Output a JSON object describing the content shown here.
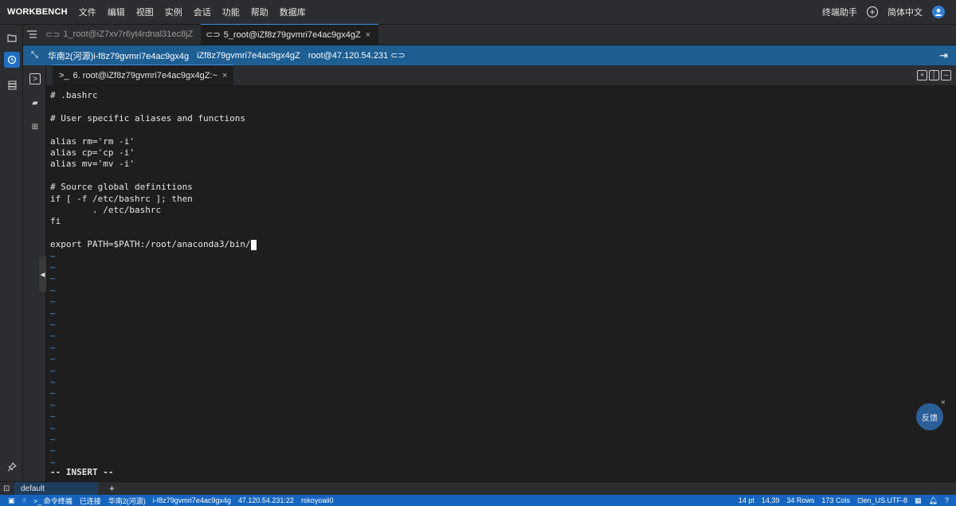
{
  "app": {
    "brand": "WORKBENCH",
    "menu": [
      "文件",
      "编辑",
      "视图",
      "实例",
      "会话",
      "功能",
      "帮助",
      "数据库"
    ],
    "assistant": "终端助手",
    "language": "简体中文"
  },
  "session_tabs": [
    {
      "label": "1_root@iZ7xv7r6yt4rdnal31ec8jZ",
      "active": false
    },
    {
      "label": "5_root@iZf8z79gvmri7e4ac9gx4gZ",
      "active": true
    }
  ],
  "infobar": {
    "region_instance": "华南2(河源)i-f8z79gvmri7e4ac9gx4g",
    "hostname": "iZf8z79gvmri7e4ac9gx4gZ",
    "login": "root@47.120.54.231"
  },
  "terminal_tab": {
    "label": "6. root@iZf8z79gvmri7e4ac9gx4gZ:~"
  },
  "terminal": {
    "lines": [
      "# .bashrc",
      "",
      "# User specific aliases and functions",
      "",
      "alias rm='rm -i'",
      "alias cp='cp -i'",
      "alias mv='mv -i'",
      "",
      "# Source global definitions",
      "if [ -f /etc/bashrc ]; then",
      "        . /etc/bashrc",
      "fi",
      "",
      "export PATH=$PATH:/root/anaconda3/bin/"
    ],
    "tilde": "~",
    "mode": "-- INSERT --"
  },
  "feedback": "反馈",
  "bottom_tab": {
    "label": "default",
    "add": "+"
  },
  "statusbar": {
    "left": [
      "命令终端",
      "已连接",
      "华南2(河源)",
      "i-f8z79gvmri7e4ac9gx4g",
      "47.120.54.231:22",
      "rskoyoaii0"
    ],
    "font_size": "14 pt",
    "cursor_pos": "14,39",
    "rows": "34 Rows",
    "cols": "173 Cols",
    "encoding": "en_US.UTF-8"
  },
  "colors": {
    "accent": "#1f6fc4",
    "infobar": "#1d5e93",
    "statusbar": "#1565c0",
    "tilde": "#4d8ec8"
  }
}
